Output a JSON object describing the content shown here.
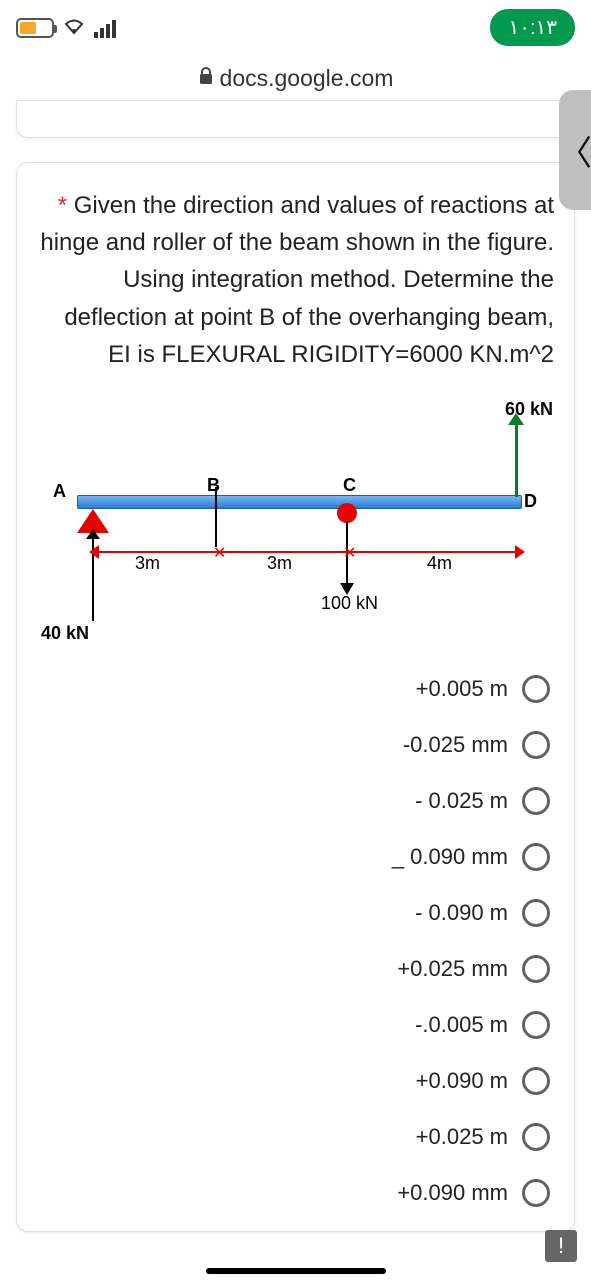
{
  "status": {
    "clock": "١٠:١٣"
  },
  "url": "docs.google.com",
  "question": {
    "required": "*",
    "text": "Given the direction and values of reactions at hinge and roller of the beam shown in the figure. Using integration method. Determine the deflection at point B of the overhanging beam, EI is FLEXURAL RIGIDITY=6000 KN.m^2"
  },
  "diagram": {
    "nodes": {
      "A": "A",
      "B": "B",
      "C": "C",
      "D": "D"
    },
    "spans": {
      "AB": "3m",
      "BC": "3m",
      "CD": "4m"
    },
    "loads": {
      "A_react": "40 kN",
      "C_point": "100 kN",
      "D_up": "60 kN"
    }
  },
  "options": [
    "+0.005 m",
    "-0.025 mm",
    "- 0.025 m",
    "_ 0.090 mm",
    "- 0.090 m",
    "+0.025 mm",
    "-.0.005 m",
    "+0.090 m",
    "+0.025 m",
    "+0.090 mm"
  ],
  "fab": "!"
}
